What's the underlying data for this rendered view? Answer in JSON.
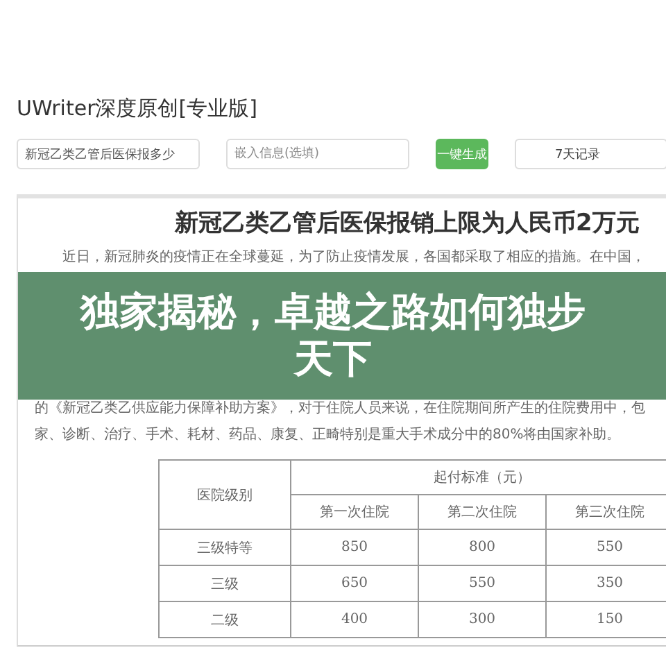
{
  "app": {
    "title": "UWriter深度原创[专业版]"
  },
  "form": {
    "keyword": {
      "value": "新冠乙类乙管后医保报多少"
    },
    "embed": {
      "placeholder": "嵌入信息(选填)"
    },
    "buttons": [
      {
        "label": "一键生成",
        "kind": "primary"
      },
      {
        "label": "7天记录",
        "kind": "secondary"
      }
    ]
  },
  "article": {
    "title": "新冠乙类乙管后医保报销上限为人民币2万元",
    "lead": "近日，新冠肺炎的疫情正在全球蔓延，为了防止疫情发展，各国都采取了相应的措施。在中国，",
    "lines": [
      "的《新冠乙类乙供应能力保障补助方案》，对于住院人员来说，在住院期间所产生的住院费用中，包",
      "家、诊断、治疗、手术、耗材、药品、康复、正畸特别是重大手术成分中的80%将由国家补助。"
    ],
    "table": {
      "row_header": "医院级别",
      "group_header": "起付标准（元）",
      "columns": [
        "第一次住院",
        "第二次住院",
        "第三次住院"
      ],
      "rows": [
        {
          "label": "三级特等",
          "cells": [
            "850",
            "800",
            "550"
          ]
        },
        {
          "label": "三级",
          "cells": [
            "650",
            "550",
            "350"
          ]
        },
        {
          "label": "二级",
          "cells": [
            "400",
            "300",
            "150"
          ]
        }
      ]
    }
  },
  "banner": {
    "headline": "独家揭秘，卓越之路如何独步天下"
  }
}
